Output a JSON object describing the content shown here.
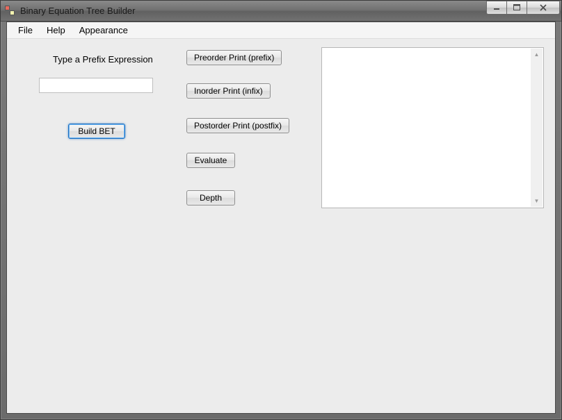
{
  "window": {
    "title": "Binary Equation Tree Builder"
  },
  "menu": {
    "file": "File",
    "help": "Help",
    "appearance": "Appearance"
  },
  "labels": {
    "prefix_prompt": "Type a Prefix Expression"
  },
  "input": {
    "expression_value": ""
  },
  "buttons": {
    "build": "Build BET",
    "preorder": "Preorder Print (prefix)",
    "inorder": "Inorder Print (infix)",
    "postorder": "Postorder Print (postfix)",
    "evaluate": "Evaluate",
    "depth": "Depth"
  },
  "output": {
    "text": ""
  }
}
